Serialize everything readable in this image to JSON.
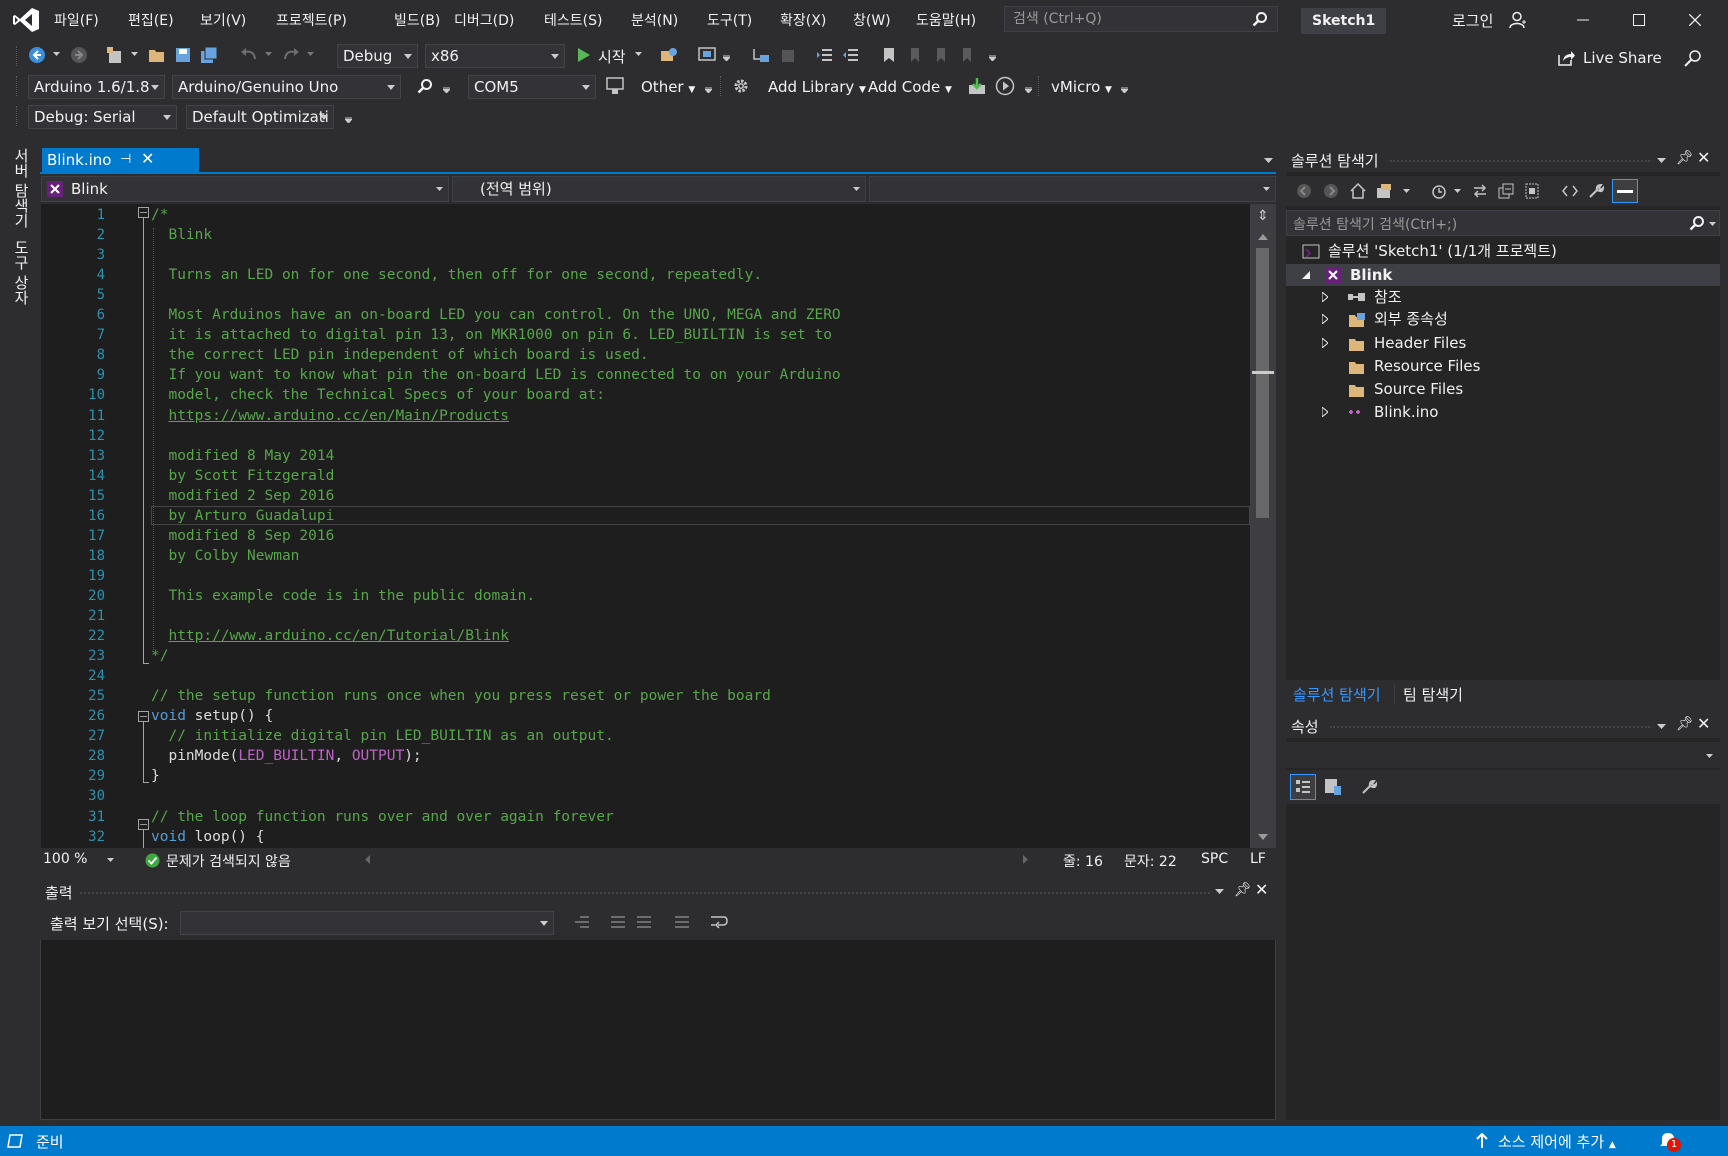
{
  "menu": [
    "파일(F)",
    "편집(E)",
    "보기(V)",
    "프로젝트(P)",
    "빌드(B)",
    "디버그(D)",
    "테스트(S)",
    "분석(N)",
    "도구(T)",
    "확장(X)",
    "창(W)",
    "도움말(H)"
  ],
  "search": {
    "placeholder": "검색 (Ctrl+Q)"
  },
  "solution_title": "Sketch1",
  "login": "로그인",
  "live_share": "Live Share",
  "toolbar1": {
    "config": "Debug",
    "platform": "x86",
    "start": "시작"
  },
  "toolbar2": {
    "ide_version": "Arduino 1.6/1.8",
    "board": "Arduino/Genuino Uno",
    "port": "COM5",
    "other": "Other",
    "add_library": "Add Library",
    "add_code": "Add Code",
    "vmicro": "vMicro"
  },
  "toolbar3": {
    "debug_mode": "Debug: Serial",
    "optimization": "Default Optimizati"
  },
  "left_strip": [
    "서버 탐색기",
    "도구 상자"
  ],
  "editor": {
    "tab": "Blink.ino",
    "nav_project": "Blink",
    "nav_scope": "(전역 범위)",
    "zoom": "100 %",
    "issues": "문제가 검색되지 않음",
    "line": "줄: 16",
    "col": "문자: 22",
    "spc": "SPC",
    "eol": "LF",
    "lines": [
      {
        "n": "1",
        "segs": [
          {
            "t": "/*",
            "c": "cm"
          }
        ]
      },
      {
        "n": "2",
        "segs": [
          {
            "t": "  Blink",
            "c": "cm"
          }
        ]
      },
      {
        "n": "3",
        "segs": [
          {
            "t": "",
            "c": "cm"
          }
        ]
      },
      {
        "n": "4",
        "segs": [
          {
            "t": "  Turns an LED on for one second, then off for one second, repeatedly.",
            "c": "cm"
          }
        ]
      },
      {
        "n": "5",
        "segs": [
          {
            "t": "",
            "c": "cm"
          }
        ]
      },
      {
        "n": "6",
        "segs": [
          {
            "t": "  Most Arduinos have an on-board LED you can control. On the UNO, MEGA and ZERO",
            "c": "cm"
          }
        ]
      },
      {
        "n": "7",
        "segs": [
          {
            "t": "  it is attached to digital pin 13, on MKR1000 on pin 6. LED_BUILTIN is set to",
            "c": "cm"
          }
        ]
      },
      {
        "n": "8",
        "segs": [
          {
            "t": "  the correct LED pin independent of which board is used.",
            "c": "cm"
          }
        ]
      },
      {
        "n": "9",
        "segs": [
          {
            "t": "  If you want to know what pin the on-board LED is connected to on your Arduino",
            "c": "cm"
          }
        ]
      },
      {
        "n": "10",
        "segs": [
          {
            "t": "  model, check the Technical Specs of your board at:",
            "c": "cm"
          }
        ]
      },
      {
        "n": "11",
        "segs": [
          {
            "t": "  ",
            "c": "cm"
          },
          {
            "t": "https://www.arduino.cc/en/Main/Products",
            "c": "lnk"
          }
        ]
      },
      {
        "n": "12",
        "segs": [
          {
            "t": "",
            "c": "cm"
          }
        ]
      },
      {
        "n": "13",
        "segs": [
          {
            "t": "  modified 8 May 2014",
            "c": "cm"
          }
        ]
      },
      {
        "n": "14",
        "segs": [
          {
            "t": "  by Scott Fitzgerald",
            "c": "cm"
          }
        ]
      },
      {
        "n": "15",
        "segs": [
          {
            "t": "  modified 2 Sep 2016",
            "c": "cm"
          }
        ]
      },
      {
        "n": "16",
        "segs": [
          {
            "t": "  by Arturo Guadalupi",
            "c": "cm"
          }
        ]
      },
      {
        "n": "17",
        "segs": [
          {
            "t": "  modified 8 Sep 2016",
            "c": "cm"
          }
        ]
      },
      {
        "n": "18",
        "segs": [
          {
            "t": "  by Colby Newman",
            "c": "cm"
          }
        ]
      },
      {
        "n": "19",
        "segs": [
          {
            "t": "",
            "c": "cm"
          }
        ]
      },
      {
        "n": "20",
        "segs": [
          {
            "t": "  This example code is in the public domain.",
            "c": "cm"
          }
        ]
      },
      {
        "n": "21",
        "segs": [
          {
            "t": "",
            "c": "cm"
          }
        ]
      },
      {
        "n": "22",
        "segs": [
          {
            "t": "  ",
            "c": "cm"
          },
          {
            "t": "http://www.arduino.cc/en/Tutorial/Blink",
            "c": "lnk"
          }
        ]
      },
      {
        "n": "23",
        "segs": [
          {
            "t": "*/",
            "c": "cm"
          }
        ]
      },
      {
        "n": "24",
        "segs": [
          {
            "t": "",
            "c": ""
          }
        ]
      },
      {
        "n": "25",
        "segs": [
          {
            "t": "// the setup function runs once when you press reset or power the board",
            "c": "cm"
          }
        ]
      },
      {
        "n": "26",
        "segs": [
          {
            "t": "void",
            "c": "kw"
          },
          {
            "t": " setup() {",
            "c": ""
          }
        ]
      },
      {
        "n": "27",
        "segs": [
          {
            "t": "  ",
            "c": ""
          },
          {
            "t": "// initialize digital pin LED_BUILTIN as an output.",
            "c": "cm"
          }
        ]
      },
      {
        "n": "28",
        "segs": [
          {
            "t": "  pinMode(",
            "c": ""
          },
          {
            "t": "LED_BUILTIN",
            "c": "mac"
          },
          {
            "t": ", ",
            "c": ""
          },
          {
            "t": "OUTPUT",
            "c": "mac"
          },
          {
            "t": ");",
            "c": ""
          }
        ]
      },
      {
        "n": "29",
        "segs": [
          {
            "t": "}",
            "c": ""
          }
        ]
      },
      {
        "n": "30",
        "segs": [
          {
            "t": "",
            "c": ""
          }
        ]
      },
      {
        "n": "31",
        "segs": [
          {
            "t": "// the loop function runs over and over again forever",
            "c": "cm"
          }
        ]
      },
      {
        "n": "32",
        "segs": [
          {
            "t": "void",
            "c": "kw"
          },
          {
            "t": " loop() {",
            "c": ""
          }
        ]
      }
    ]
  },
  "output": {
    "title": "출력",
    "select_label": "출력 보기 선택(S):"
  },
  "solution_explorer": {
    "title": "솔루션 탐색기",
    "search_placeholder": "솔루션 탐색기 검색(Ctrl+;)",
    "solution_node": "솔루션 'Sketch1' (1/1개 프로젝트)",
    "project": "Blink",
    "items": [
      "참조",
      "외부 종속성",
      "Header Files",
      "Resource Files",
      "Source Files",
      "Blink.ino"
    ],
    "tab_solution": "솔루션 탐색기",
    "tab_team": "팀 탐색기"
  },
  "properties": {
    "title": "속성"
  },
  "status": {
    "ready": "준비",
    "source_control": "소스 제어에 추가",
    "notif_count": "1"
  },
  "colors": {
    "accent": "#007acc",
    "comment": "#57a64a",
    "keyword": "#569cd6",
    "macro": "#bd63c5",
    "line_number": "#2b91af"
  }
}
